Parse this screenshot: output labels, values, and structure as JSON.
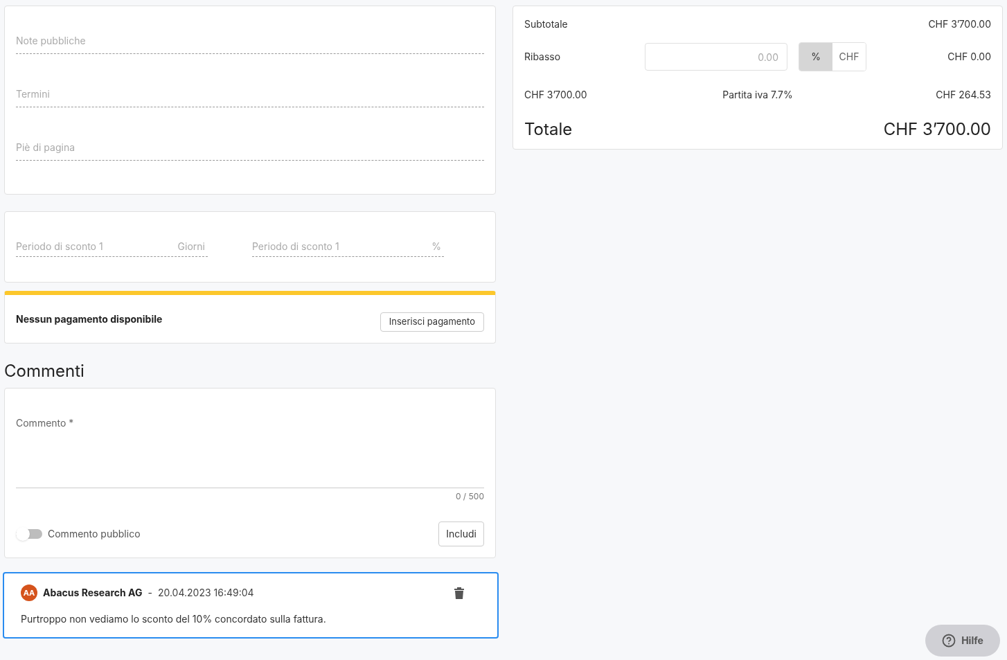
{
  "notes": {
    "fields": [
      {
        "placeholder": "Note pubbliche"
      },
      {
        "placeholder": "Termini"
      },
      {
        "placeholder": "Piè di pagina"
      }
    ]
  },
  "discount_periods": [
    {
      "placeholder": "Periodo di sconto 1",
      "unit": "Giorni"
    },
    {
      "placeholder": "Periodo di sconto 1",
      "unit": "%"
    }
  ],
  "payment": {
    "message": "Nessun pagamento disponibile",
    "button": "Inserisci pagamento"
  },
  "comments": {
    "title": "Commenti",
    "placeholder": "Commento *",
    "counter": "0 / 500",
    "public_switch": {
      "label": "Commento pubblico",
      "on": false
    },
    "submit": "Includi",
    "items": [
      {
        "initials": "AA",
        "author": "Abacus Research AG",
        "separator": "-",
        "date": "20.04.2023 16:49:04",
        "text": "Purtroppo non vediamo lo sconto del 10% concordato sulla fattura.",
        "selected": true
      }
    ]
  },
  "summary": {
    "subtotal_label": "Subtotale",
    "subtotal": "CHF 3’700.00",
    "discount_label": "Ribasso",
    "discount_placeholder": "0.00",
    "units": [
      {
        "label": "%",
        "selected": true
      },
      {
        "label": "CHF",
        "selected": false
      }
    ],
    "discount_amount": "CHF 0.00",
    "net": "CHF 3’700.00",
    "vat_label": "Partita iva 7.7%",
    "vat": "CHF 264.53",
    "total_label": "Totale",
    "total": "CHF 3’700.00"
  },
  "help": {
    "label": "Hilfe"
  }
}
